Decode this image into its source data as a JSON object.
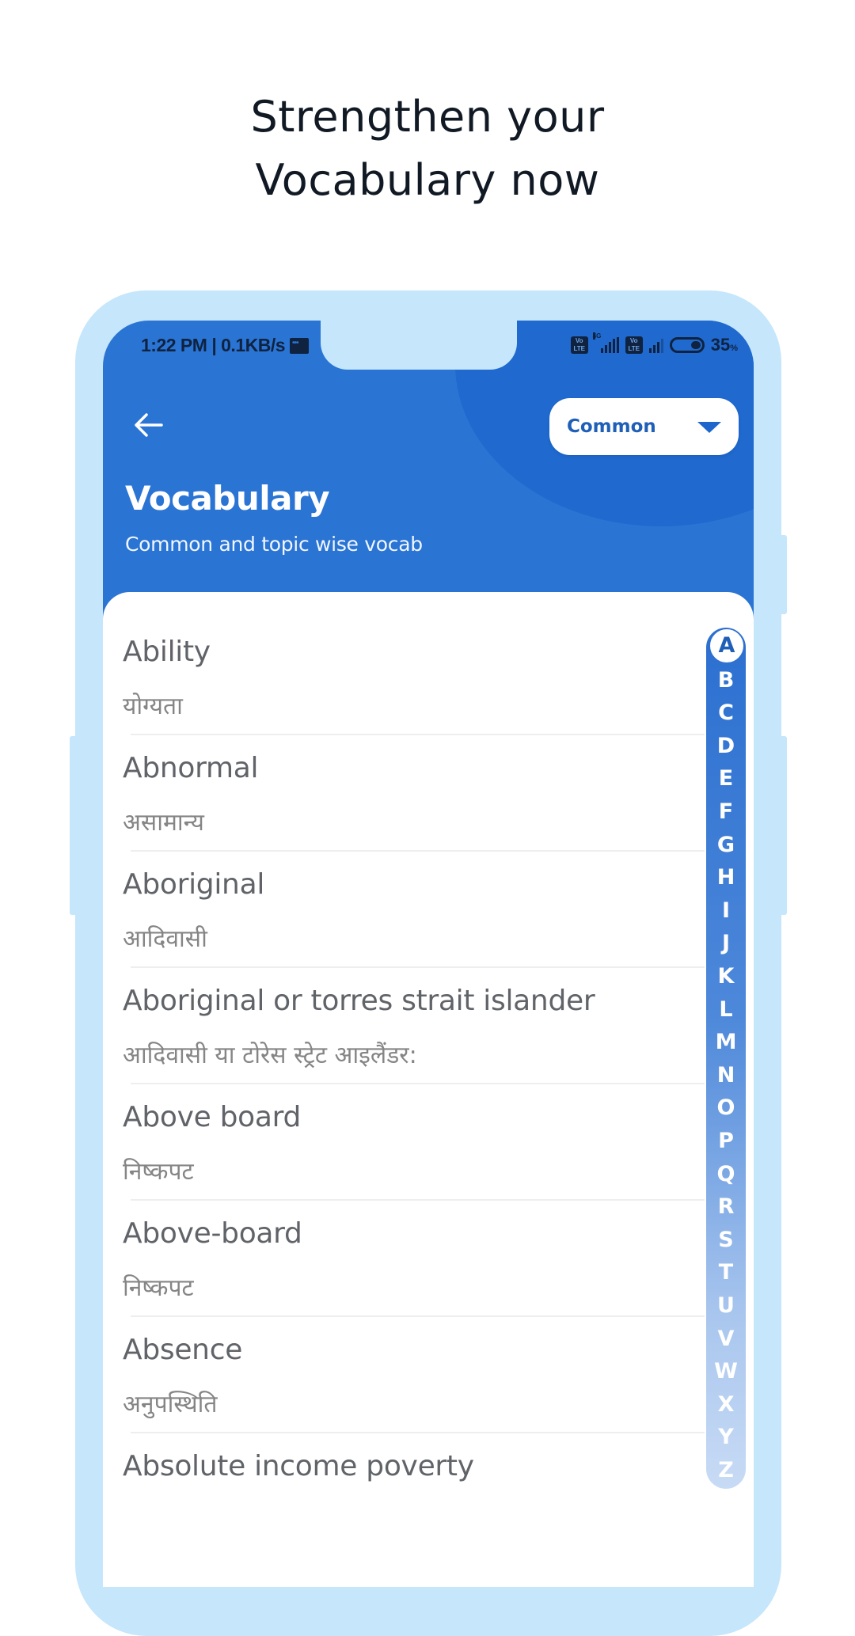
{
  "promo": {
    "headline_line1": "Strengthen your",
    "headline_line2": "Vocabulary now"
  },
  "status_bar": {
    "time_speed": "1:22 PM | 0.1KB/s",
    "volte_label": "Vo LTE",
    "network_label": "4G",
    "battery_percent": "35",
    "battery_unit": "%"
  },
  "header": {
    "back_icon": "arrow-left-icon",
    "dropdown_value": "Common",
    "dropdown_icon": "caret-down-icon",
    "title": "Vocabulary",
    "subtitle": "Common and topic wise vocab"
  },
  "colors": {
    "header_blue": "#2a74d4",
    "frame_light_blue": "#c5e6fb",
    "dropdown_text": "#1f5fb8"
  },
  "words": [
    {
      "en": "Ability",
      "hi": "योग्यता"
    },
    {
      "en": "Abnormal",
      "hi": "असामान्य"
    },
    {
      "en": "Aboriginal",
      "hi": "आदिवासी"
    },
    {
      "en": "Aboriginal or torres strait islander",
      "hi": "आदिवासी या टोरेस स्ट्रेट आइलैंडर:"
    },
    {
      "en": "Above board",
      "hi": " निष्कपट"
    },
    {
      "en": "Above-board",
      "hi": "निष्कपट"
    },
    {
      "en": "Absence",
      "hi": "अनुपस्थिति"
    },
    {
      "en": "Absolute income poverty",
      "hi": ""
    }
  ],
  "alphabet_index": {
    "active": "A",
    "letters": [
      "A",
      "B",
      "C",
      "D",
      "E",
      "F",
      "G",
      "H",
      "I",
      "J",
      "K",
      "L",
      "M",
      "N",
      "O",
      "P",
      "Q",
      "R",
      "S",
      "T",
      "U",
      "V",
      "W",
      "X",
      "Y",
      "Z"
    ]
  }
}
